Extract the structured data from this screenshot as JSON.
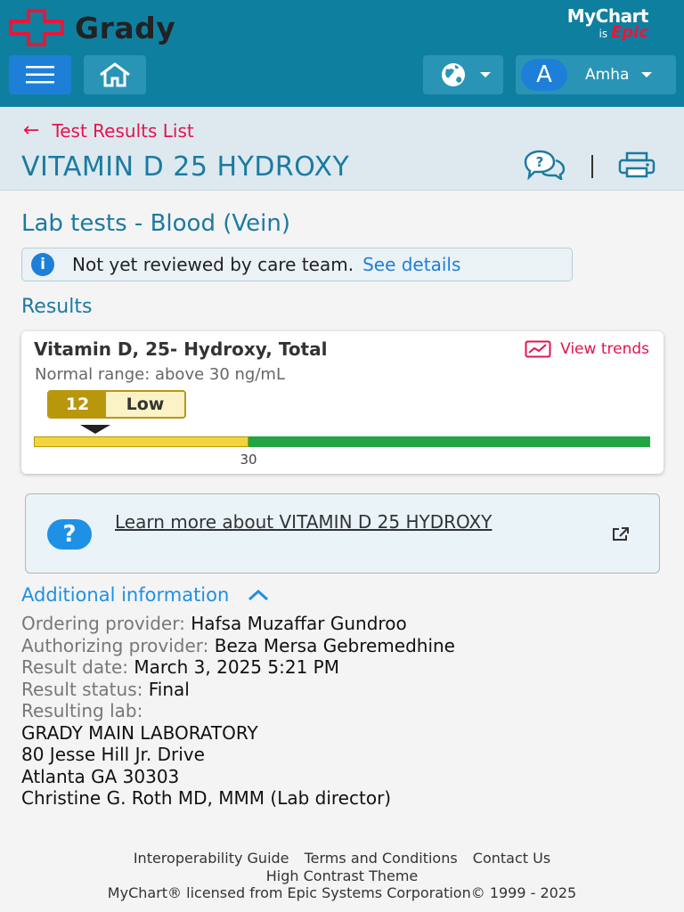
{
  "header": {
    "brand_name": "Grady",
    "mychart_label": "MyChart",
    "is_label": "is",
    "epic_label": "Epic",
    "user": {
      "initial": "A",
      "name": "Amha"
    }
  },
  "page": {
    "back_link": "Test Results List",
    "title": "VITAMIN D 25 HYDROXY",
    "lab_heading": "Lab tests - Blood (Vein)",
    "notice": {
      "text": "Not yet reviewed by care team.",
      "link": "See details"
    },
    "results_heading": "Results"
  },
  "result": {
    "name": "Vitamin D, 25- Hydroxy, Total",
    "view_trends": "View trends",
    "normal_range": "Normal range: above 30 ng/mL",
    "value": "12",
    "flag": "Low",
    "threshold_label": "30",
    "value_num": 12,
    "threshold_num": 30,
    "scale_max_num": 86
  },
  "learn_more": "Learn more about VITAMIN D 25 HYDROXY",
  "additional": {
    "heading": "Additional information",
    "ordering_label": "Ordering provider:",
    "ordering_value": "Hafsa Muzaffar Gundroo",
    "authorizing_label": "Authorizing provider:",
    "authorizing_value": "Beza Mersa Gebremedhine",
    "date_label": "Result date:",
    "date_value": "March 3, 2025 5:21 PM",
    "status_label": "Result status:",
    "status_value": "Final",
    "lab_label": "Resulting lab:",
    "lab_name": "GRADY MAIN LABORATORY",
    "lab_address1": "80 Jesse Hill Jr. Drive",
    "lab_address2": "Atlanta GA 30303",
    "lab_director": "Christine G. Roth MD, MMM (Lab director)"
  },
  "footer": {
    "link1": "Interoperability Guide",
    "link2": "Terms and Conditions",
    "link3": "Contact Us",
    "theme": "High Contrast Theme",
    "license": "MyChart® licensed from Epic Systems Corporation© 1999 - 2025"
  },
  "colors": {
    "header_bg": "#0f7fa0",
    "accent_red": "#e3144e",
    "title_blue": "#1b7aa1",
    "low_yellow": "#f2d53c",
    "normal_green": "#22a542"
  }
}
